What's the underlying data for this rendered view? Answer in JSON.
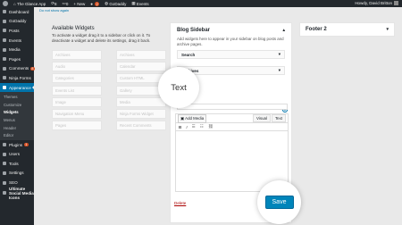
{
  "adminbar": {
    "site_name": "The Glance App",
    "comments_count": "8",
    "updates_count": "0",
    "new_label": "+ New",
    "notifications_count": "2",
    "godaddy_label": "GoDaddy",
    "events_label": "Events",
    "howdy": "Howdy, David Britton"
  },
  "sidebar": {
    "items": [
      {
        "label": "Dashboard"
      },
      {
        "label": "GoDaddy"
      },
      {
        "label": "Posts"
      },
      {
        "label": "Events"
      },
      {
        "label": "Media"
      },
      {
        "label": "Pages"
      },
      {
        "label": "Comments",
        "count": "8"
      },
      {
        "label": "Ninja Forms"
      },
      {
        "label": "Appearance"
      }
    ],
    "submenu": [
      "Themes",
      "Customize",
      "Widgets",
      "Menus",
      "Header",
      "Editor"
    ],
    "items_after": [
      {
        "label": "Plugins",
        "count": "1"
      },
      {
        "label": "Users"
      },
      {
        "label": "Tools"
      },
      {
        "label": "Settings"
      },
      {
        "label": "SEO"
      },
      {
        "label": "Ultimate Social Media Icons"
      }
    ]
  },
  "main": {
    "notice_link": "Do not show again",
    "title": "Available Widgets",
    "description": "To activate a widget drag it to a sidebar or click on it. To deactivate a widget and delete its settings, drag it back.",
    "widgets": [
      [
        "Archives",
        "Archives"
      ],
      [
        "Audio",
        "Calendar"
      ],
      [
        "Categories",
        "Custom HTML"
      ],
      [
        "Events List",
        "Gallery"
      ],
      [
        "Image",
        "Media"
      ],
      [
        "Navigation Menu",
        "Ninja Forms Widget"
      ],
      [
        "Pages",
        "Recent Comments"
      ]
    ]
  },
  "blog_sidebar": {
    "title": "Blog Sidebar",
    "description": "Add widgets here to appear in your sidebar on blog posts and archive pages.",
    "widgets": [
      "Search",
      "Archives"
    ],
    "add_media": "Add Media",
    "tab_visual": "Visual",
    "tab_text": "Text",
    "delete": "Delete"
  },
  "footer": {
    "title": "Footer 2"
  },
  "callouts": {
    "text": "Text",
    "save": "Save"
  }
}
